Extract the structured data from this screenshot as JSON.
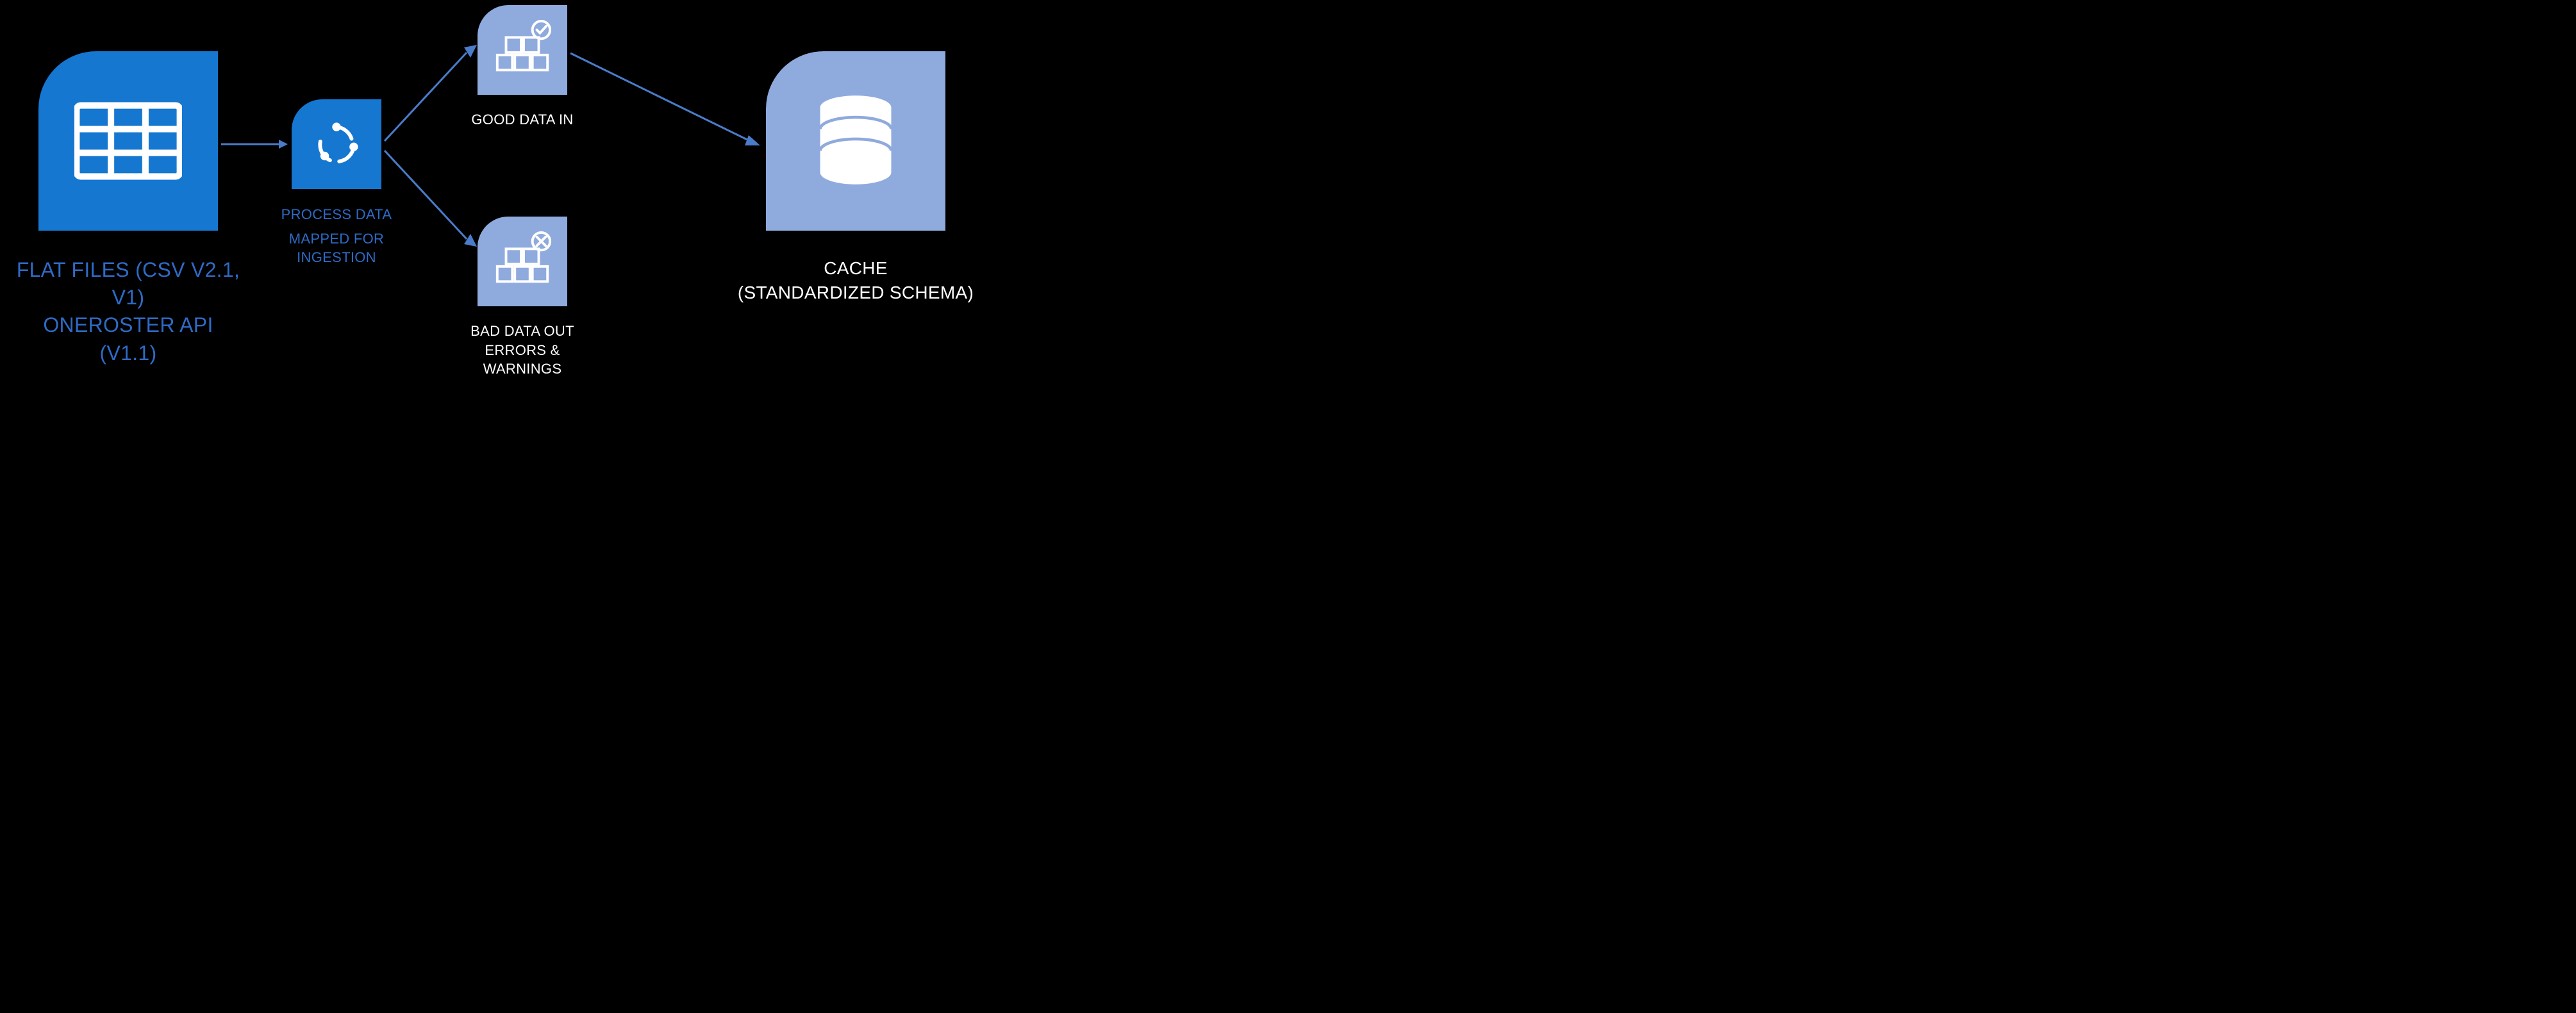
{
  "diagram": {
    "source": {
      "line1": "FLAT FILES (CSV V2.1, V1)",
      "line2": "ONEROSTER API (V1.1)"
    },
    "process": {
      "line1": "PROCESS DATA",
      "line2": "MAPPED FOR",
      "line3": "INGESTION"
    },
    "good": {
      "label": "GOOD DATA IN"
    },
    "bad": {
      "line1": "BAD DATA OUT",
      "line2": "ERRORS & WARNINGS"
    },
    "cache": {
      "line1": "CACHE",
      "line2": "(STANDARDIZED SCHEMA)"
    }
  }
}
